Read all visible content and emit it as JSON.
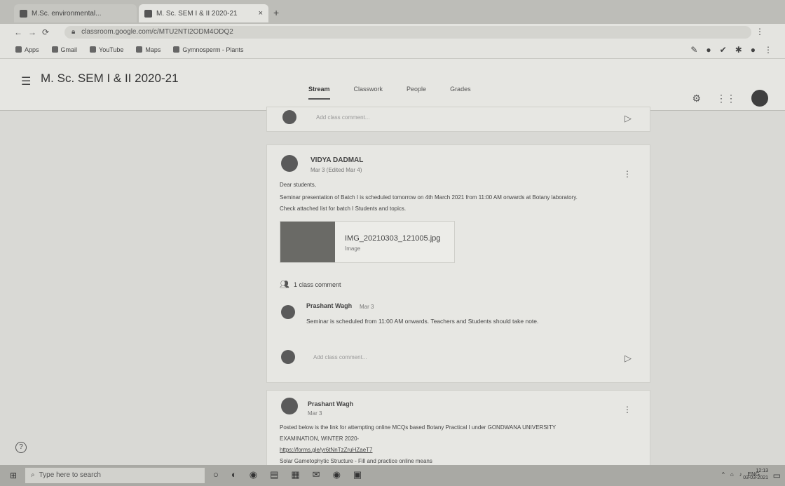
{
  "browser": {
    "tabs": [
      {
        "label": "M.Sc. environmental..."
      },
      {
        "label": "M. Sc. SEM I & II 2020-21",
        "close": "×"
      }
    ],
    "new_tab": "+",
    "url": "classroom.google.com/c/MTU2NTI2ODM4ODQ2",
    "bookmarks": [
      "Apps",
      "Gmail",
      "YouTube",
      "Maps",
      "Gymnosperm - Plants"
    ]
  },
  "header": {
    "class_name": "M. Sc. SEM I & II 2020-21",
    "tabs": [
      "Stream",
      "Classwork",
      "People",
      "Grades"
    ]
  },
  "stream": {
    "top_comment_placeholder": "Add class comment...",
    "post1": {
      "author": "VIDYA DADMAL",
      "date": "Mar 3 (Edited Mar 4)",
      "lines": [
        "Dear students,",
        "Seminar presentation of Batch I is scheduled tomorrow on 4th March 2021 from 11:00 AM onwards at Botany laboratory.",
        "Check attached list for batch I Students and topics."
      ],
      "attachment": {
        "name": "IMG_20210303_121005.jpg",
        "type": "Image"
      },
      "class_comments": "1 class comment",
      "comment": {
        "author": "Prashant Wagh",
        "date": "Mar 3",
        "text": "Seminar is scheduled from 11:00 AM onwards. Teachers and Students should take note."
      },
      "comment_placeholder": "Add class comment..."
    },
    "post2": {
      "author": "Prashant Wagh",
      "date": "Mar 3",
      "lines": [
        "Posted below is the link for attempting online MCQs based Botany Practical I under GONDWANA UNIVERSITY",
        "EXAMINATION, WINTER 2020-",
        "https://forms.gle/yr6tNnTzZruHZaeT7",
        "Solar Gametophytic Structure - Fill and practice online means"
      ]
    }
  },
  "taskbar": {
    "search_placeholder": "Type here to search",
    "tray_lang": "ENG",
    "time": "12:13",
    "date": "03-03-2021"
  }
}
